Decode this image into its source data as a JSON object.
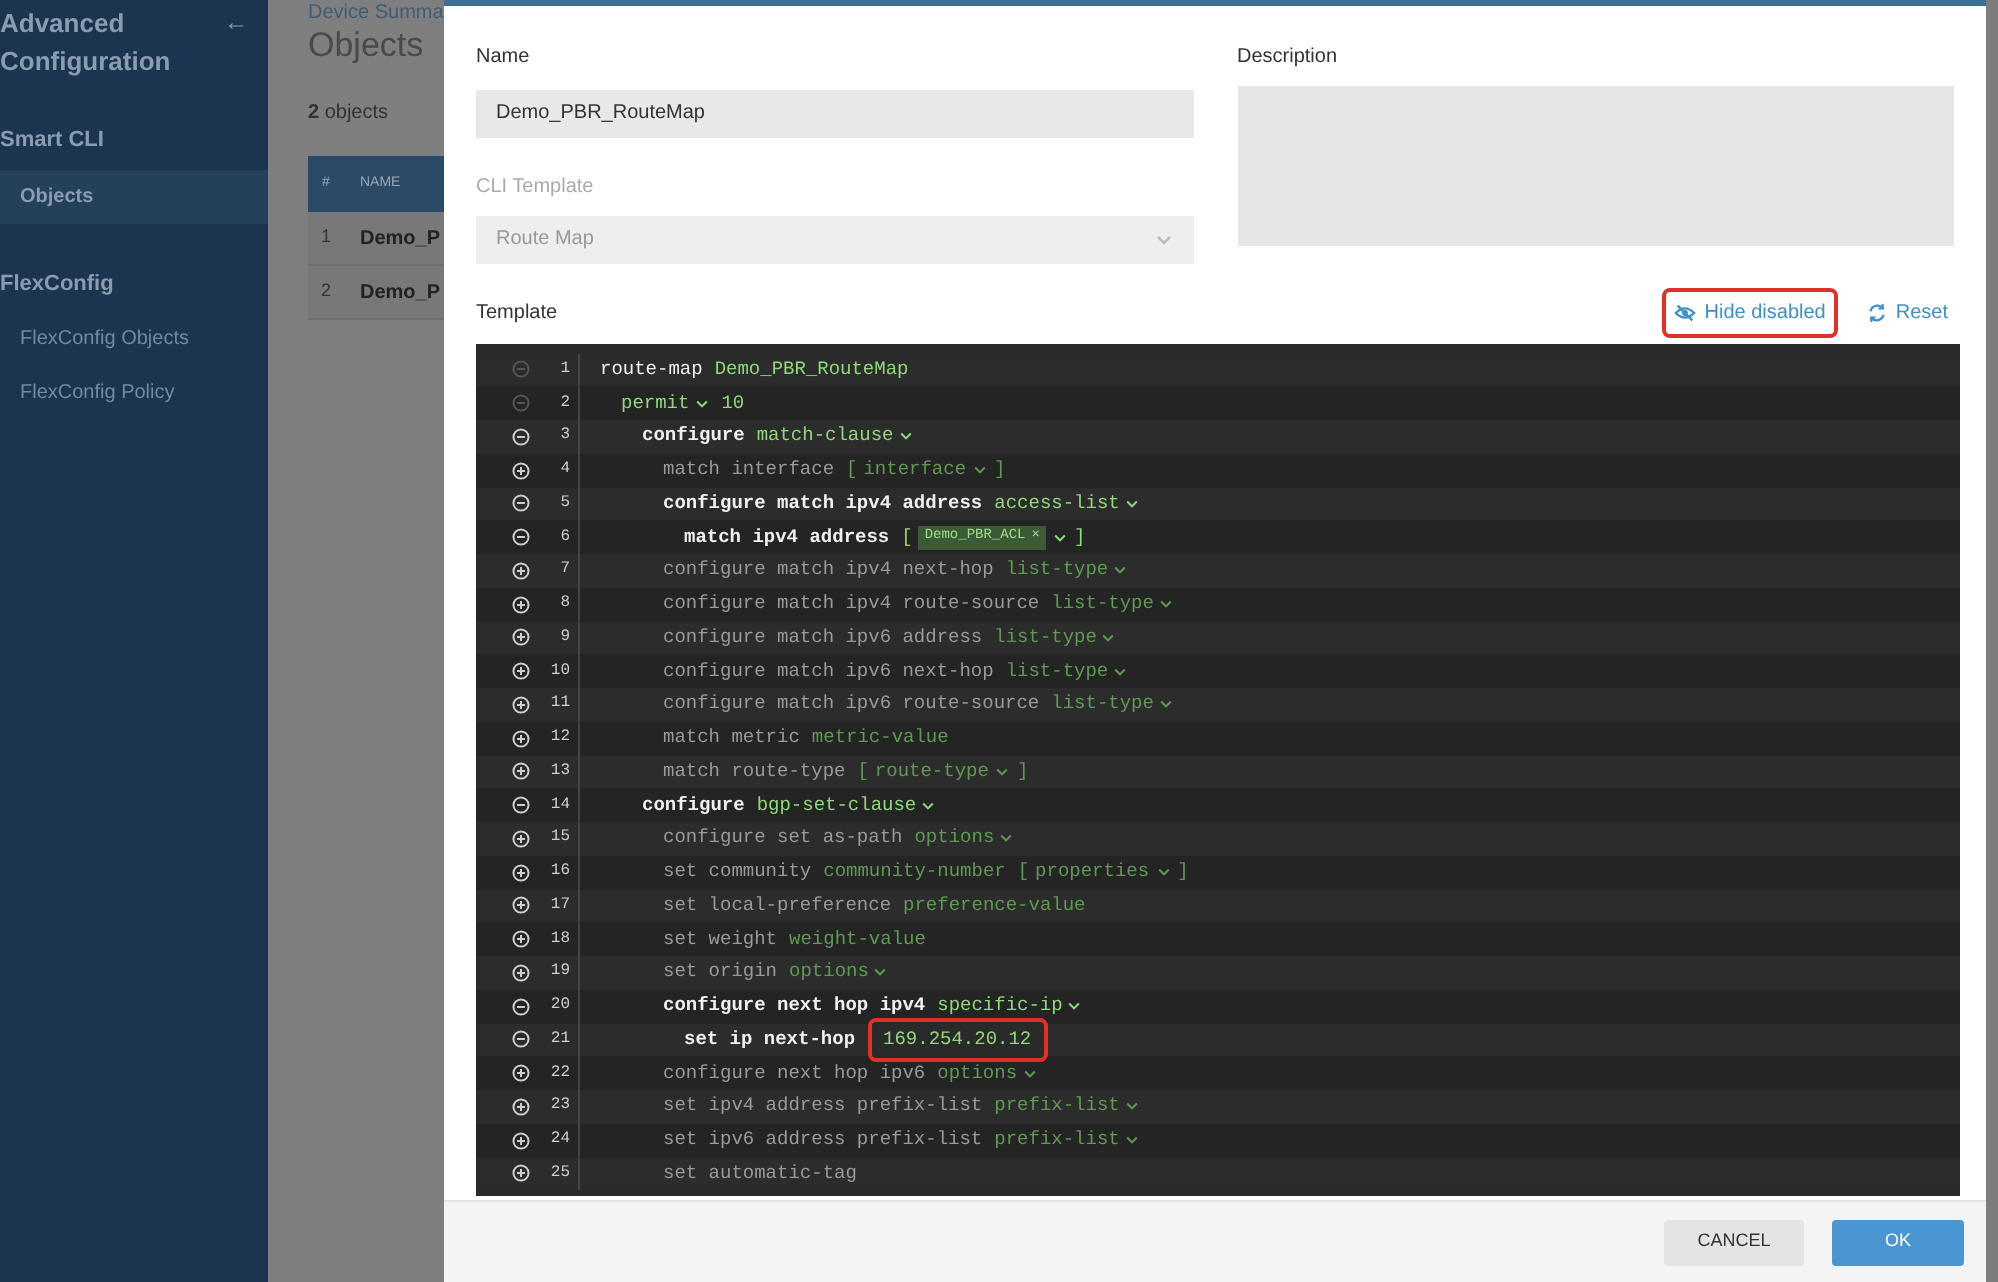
{
  "sidebar": {
    "title": "Advanced Configuration",
    "back_icon": "←",
    "sections": [
      {
        "heading": "Smart CLI",
        "items": [
          {
            "label": "Objects",
            "selected": true
          }
        ]
      },
      {
        "heading": "FlexConfig",
        "items": [
          {
            "label": "FlexConfig Objects",
            "selected": false
          },
          {
            "label": "FlexConfig Policy",
            "selected": false
          }
        ]
      }
    ]
  },
  "page": {
    "breadcrumb": "Device Summa",
    "title": "Objects",
    "count": "**2** objects",
    "table": {
      "columns": [
        "#",
        "NAME"
      ],
      "rows": [
        [
          "1",
          "Demo_P"
        ],
        [
          "2",
          "Demo_P"
        ]
      ]
    }
  },
  "dialog": {
    "name": {
      "label": "Name",
      "value": "Demo_PBR_RouteMap"
    },
    "cli_template": {
      "label": "CLI Template",
      "value": "Route Map",
      "disabled": true
    },
    "description": {
      "label": "Description"
    },
    "template": {
      "label": "Template",
      "actions": [
        {
          "kind": "hide",
          "label": "Hide disabled",
          "highlighted": true
        },
        {
          "kind": "reset",
          "label": "Reset",
          "highlighted": false
        }
      ],
      "lines": [
        {
          "number": "1",
          "enabled": true,
          "locked": true,
          "parts": [
            {
              "kind": "keyword",
              "text": "route-map"
            },
            {
              "kind": "value",
              "text": "Demo_PBR_RouteMap"
            }
          ],
          "children": [
            {
              "number": "2",
              "enabled": true,
              "locked": true,
              "parts": [
                {
                  "kind": "dropdown",
                  "text": "permit"
                },
                {
                  "kind": "value",
                  "text": "10"
                }
              ],
              "children": [
                {
                  "number": "3",
                  "enabled": true,
                  "locked": false,
                  "parts": [
                    {
                      "kind": "keyword",
                      "text": "configure"
                    },
                    {
                      "kind": "dropdown",
                      "text": "match-clause"
                    }
                  ],
                  "children": [
                    {
                      "number": "4",
                      "enabled": false,
                      "locked": false,
                      "parts": [
                        {
                          "kind": "keyword",
                          "text": "match interface"
                        },
                        {
                          "kind": "list",
                          "open": "[",
                          "text": "interface",
                          "close": "]"
                        }
                      ]
                    },
                    {
                      "number": "5",
                      "enabled": true,
                      "locked": false,
                      "parts": [
                        {
                          "kind": "keyword",
                          "text": "configure match ipv4 address"
                        },
                        {
                          "kind": "dropdown",
                          "text": "access-list"
                        }
                      ],
                      "children": [
                        {
                          "number": "6",
                          "enabled": true,
                          "locked": false,
                          "parts": [
                            {
                              "kind": "keyword",
                              "text": "match ipv4 address"
                            },
                            {
                              "kind": "list",
                              "open": "[",
                              "chip": "Demo_PBR_ACL",
                              "remove": "×",
                              "close": "]"
                            }
                          ]
                        }
                      ]
                    },
                    {
                      "number": "7",
                      "enabled": false,
                      "locked": false,
                      "parts": [
                        {
                          "kind": "keyword",
                          "text": "configure match ipv4 next-hop"
                        },
                        {
                          "kind": "dropdown",
                          "text": "list-type"
                        }
                      ]
                    },
                    {
                      "number": "8",
                      "enabled": false,
                      "locked": false,
                      "parts": [
                        {
                          "kind": "keyword",
                          "text": "configure match ipv4 route-source"
                        },
                        {
                          "kind": "dropdown",
                          "text": "list-type"
                        }
                      ]
                    },
                    {
                      "number": "9",
                      "enabled": false,
                      "locked": false,
                      "parts": [
                        {
                          "kind": "keyword",
                          "text": "configure match ipv6 address"
                        },
                        {
                          "kind": "dropdown",
                          "text": "list-type"
                        }
                      ]
                    },
                    {
                      "number": "10",
                      "enabled": false,
                      "locked": false,
                      "parts": [
                        {
                          "kind": "keyword",
                          "text": "configure match ipv6 next-hop"
                        },
                        {
                          "kind": "dropdown",
                          "text": "list-type"
                        }
                      ]
                    },
                    {
                      "number": "11",
                      "enabled": false,
                      "locked": false,
                      "parts": [
                        {
                          "kind": "keyword",
                          "text": "configure match ipv6 route-source"
                        },
                        {
                          "kind": "dropdown",
                          "text": "list-type"
                        }
                      ]
                    },
                    {
                      "number": "12",
                      "enabled": false,
                      "locked": false,
                      "parts": [
                        {
                          "kind": "keyword",
                          "text": "match metric"
                        },
                        {
                          "kind": "value",
                          "text": "metric-value"
                        }
                      ]
                    },
                    {
                      "number": "13",
                      "enabled": false,
                      "locked": false,
                      "parts": [
                        {
                          "kind": "keyword",
                          "text": "match route-type"
                        },
                        {
                          "kind": "list",
                          "open": "[",
                          "text": "route-type",
                          "close": "]"
                        }
                      ]
                    }
                  ]
                },
                {
                  "number": "14",
                  "enabled": true,
                  "locked": false,
                  "parts": [
                    {
                      "kind": "keyword",
                      "text": "configure"
                    },
                    {
                      "kind": "dropdown",
                      "text": "bgp-set-clause"
                    }
                  ],
                  "children": [
                    {
                      "number": "15",
                      "enabled": false,
                      "locked": false,
                      "parts": [
                        {
                          "kind": "keyword",
                          "text": "configure set as-path"
                        },
                        {
                          "kind": "dropdown",
                          "text": "options"
                        }
                      ]
                    },
                    {
                      "number": "16",
                      "enabled": false,
                      "locked": false,
                      "parts": [
                        {
                          "kind": "keyword",
                          "text": "set community"
                        },
                        {
                          "kind": "value",
                          "text": "community-number"
                        },
                        {
                          "kind": "list",
                          "open": "[",
                          "text": "properties",
                          "close": "]"
                        }
                      ]
                    },
                    {
                      "number": "17",
                      "enabled": false,
                      "locked": false,
                      "parts": [
                        {
                          "kind": "keyword",
                          "text": "set local-preference"
                        },
                        {
                          "kind": "value",
                          "text": "preference-value"
                        }
                      ]
                    },
                    {
                      "number": "18",
                      "enabled": false,
                      "locked": false,
                      "parts": [
                        {
                          "kind": "keyword",
                          "text": "set weight"
                        },
                        {
                          "kind": "value",
                          "text": "weight-value"
                        }
                      ]
                    },
                    {
                      "number": "19",
                      "enabled": false,
                      "locked": false,
                      "parts": [
                        {
                          "kind": "keyword",
                          "text": "set origin"
                        },
                        {
                          "kind": "dropdown",
                          "text": "options"
                        }
                      ]
                    },
                    {
                      "number": "20",
                      "enabled": true,
                      "locked": false,
                      "parts": [
                        {
                          "kind": "keyword",
                          "text": "configure next hop ipv4"
                        },
                        {
                          "kind": "dropdown",
                          "text": "specific-ip"
                        }
                      ],
                      "children": [
                        {
                          "number": "21",
                          "enabled": true,
                          "locked": false,
                          "parts": [
                            {
                              "kind": "keyword",
                              "text": "set ip next-hop"
                            },
                            {
                              "kind": "value",
                              "text": "169.254.20.12",
                              "highlighted": true
                            }
                          ]
                        }
                      ]
                    },
                    {
                      "number": "22",
                      "enabled": false,
                      "locked": false,
                      "parts": [
                        {
                          "kind": "keyword",
                          "text": "configure next hop ipv6"
                        },
                        {
                          "kind": "dropdown",
                          "text": "options"
                        }
                      ]
                    },
                    {
                      "number": "23",
                      "enabled": false,
                      "locked": false,
                      "parts": [
                        {
                          "kind": "keyword",
                          "text": "set ipv4 address prefix-list"
                        },
                        {
                          "kind": "dropdown",
                          "text": "prefix-list"
                        }
                      ]
                    },
                    {
                      "number": "24",
                      "enabled": false,
                      "locked": false,
                      "parts": [
                        {
                          "kind": "keyword",
                          "text": "set ipv6 address prefix-list"
                        },
                        {
                          "kind": "dropdown",
                          "text": "prefix-list"
                        }
                      ]
                    },
                    {
                      "number": "25",
                      "enabled": false,
                      "locked": false,
                      "parts": [
                        {
                          "kind": "keyword",
                          "text": "set automatic-tag"
                        }
                      ]
                    }
                  ]
                }
              ]
            }
          ]
        }
      ]
    },
    "buttons": [
      {
        "kind": "secondary",
        "label": "CANCEL"
      },
      {
        "kind": "primary",
        "label": "OK"
      }
    ]
  }
}
